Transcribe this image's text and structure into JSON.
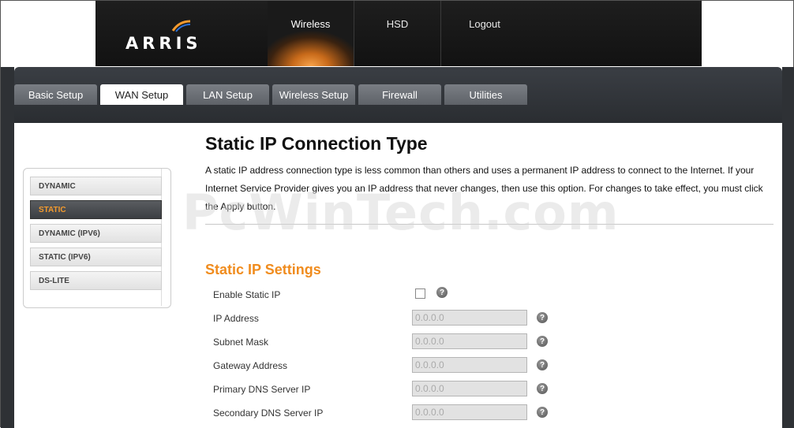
{
  "brand": {
    "logo_text": "ARRIS"
  },
  "top_nav": [
    {
      "label": "Wireless",
      "active": true
    },
    {
      "label": "HSD",
      "active": false
    },
    {
      "label": "Logout",
      "active": false
    }
  ],
  "tabs": [
    {
      "label": "Basic Setup",
      "active": false
    },
    {
      "label": "WAN Setup",
      "active": true
    },
    {
      "label": "LAN Setup",
      "active": false
    },
    {
      "label": "Wireless Setup",
      "active": false
    },
    {
      "label": "Firewall",
      "active": false
    },
    {
      "label": "Utilities",
      "active": false
    }
  ],
  "side_nav": [
    {
      "label": "DYNAMIC",
      "active": false
    },
    {
      "label": "STATIC",
      "active": true
    },
    {
      "label": "DYNAMIC (IPV6)",
      "active": false
    },
    {
      "label": "STATIC (IPV6)",
      "active": false
    },
    {
      "label": "DS-LITE",
      "active": false
    }
  ],
  "page": {
    "title": "Static IP Connection Type",
    "description": "A static IP address connection type is less common than others and uses a permanent IP address to connect to the Internet. If your Internet Service Provider gives you an IP address that never changes, then use this option. For changes to take effect, you must click the Apply button.",
    "section_title": "Static IP Settings"
  },
  "settings": {
    "enable_label": "Enable Static IP",
    "enable_checked": false,
    "fields": [
      {
        "label": "IP Address",
        "value": "0.0.0.0"
      },
      {
        "label": "Subnet Mask",
        "value": "0.0.0.0"
      },
      {
        "label": "Gateway Address",
        "value": "0.0.0.0"
      },
      {
        "label": "Primary DNS Server IP",
        "value": "0.0.0.0"
      },
      {
        "label": "Secondary DNS Server IP",
        "value": "0.0.0.0"
      }
    ],
    "help_glyph": "?"
  },
  "watermark": "PcWinTech.com",
  "colors": {
    "accent": "#f08c1e",
    "dark": "#2e3135"
  }
}
